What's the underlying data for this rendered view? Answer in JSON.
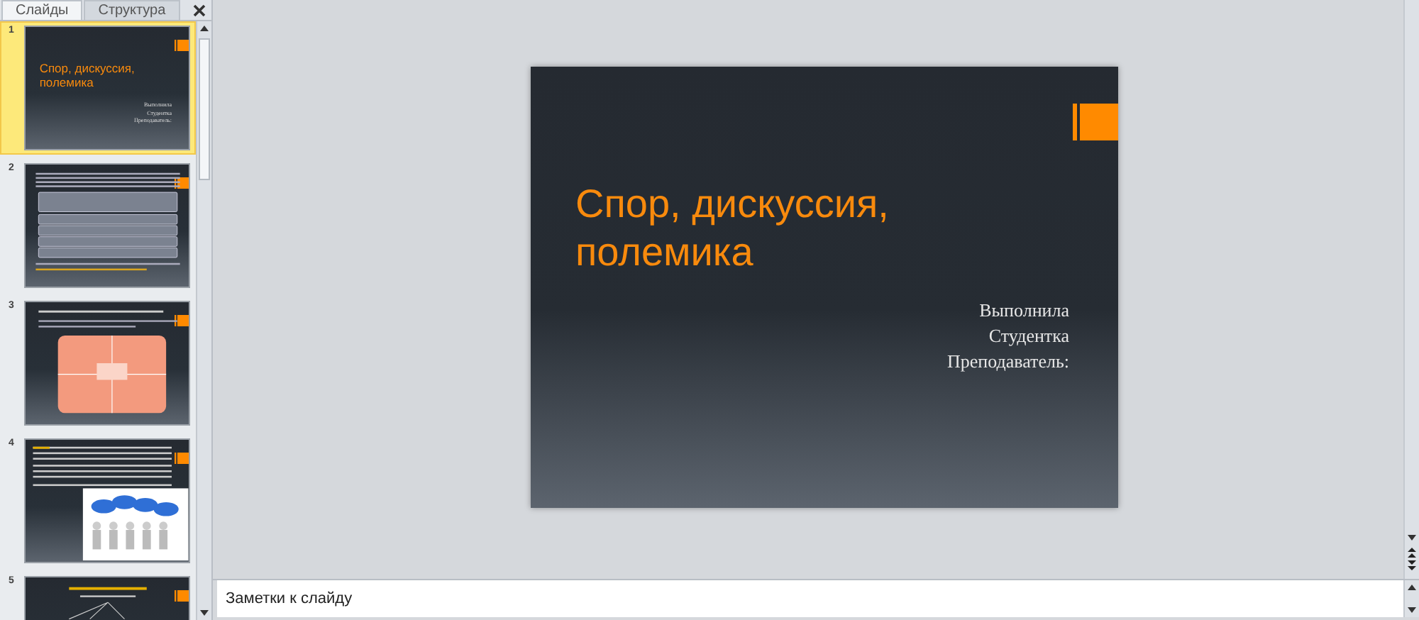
{
  "panel": {
    "tabs": [
      {
        "label": "Слайды",
        "selected": true
      },
      {
        "label": "Структура",
        "selected": false
      }
    ]
  },
  "thumbnails": [
    {
      "number": "1",
      "selected": true,
      "kind": "title",
      "title": "Спор, дискуссия, полемика",
      "subtitle_lines": [
        "Выполнила",
        "Студентка",
        "Преподаватель:"
      ]
    },
    {
      "number": "2",
      "selected": false,
      "kind": "list"
    },
    {
      "number": "3",
      "selected": false,
      "kind": "diagram"
    },
    {
      "number": "4",
      "selected": false,
      "kind": "photo"
    },
    {
      "number": "5",
      "selected": false,
      "kind": "heading"
    }
  ],
  "slide": {
    "title": "Спор, дискуссия, полемика",
    "subtitle_lines": [
      "Выполнила",
      "Студентка",
      "Преподаватель:"
    ]
  },
  "notes": {
    "placeholder": "Заметки к слайду"
  }
}
